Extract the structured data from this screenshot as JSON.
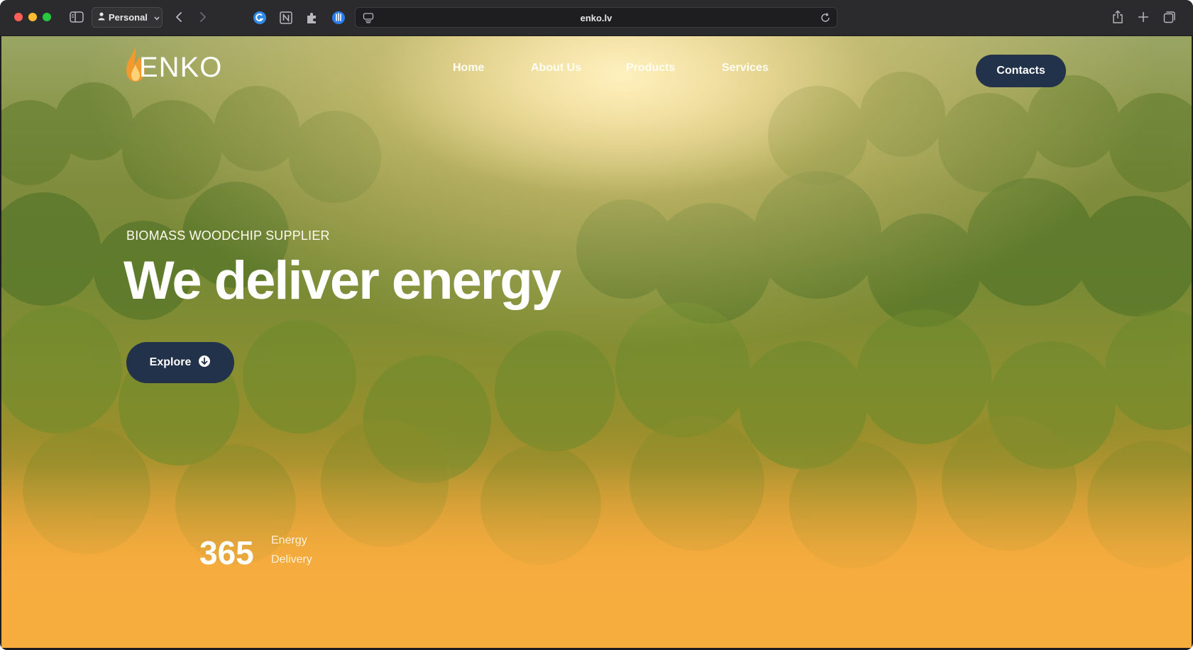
{
  "browser": {
    "profile_label": "Personal",
    "url": "enko.lv"
  },
  "site": {
    "logo_text": "ENKO",
    "nav": {
      "home": "Home",
      "about": "About Us",
      "products": "Products",
      "services": "Services"
    },
    "contacts_label": "Contacts"
  },
  "hero": {
    "eyebrow": "BIOMASS WOODCHIP SUPPLIER",
    "headline": "We deliver energy",
    "explore_label": "Explore"
  },
  "stats": {
    "number": "365",
    "line1": "Energy",
    "line2": "Delivery"
  },
  "colors": {
    "button_navy": "#22324a",
    "accent_orange": "#f7ac3e",
    "flame_orange": "#f29a2e"
  }
}
